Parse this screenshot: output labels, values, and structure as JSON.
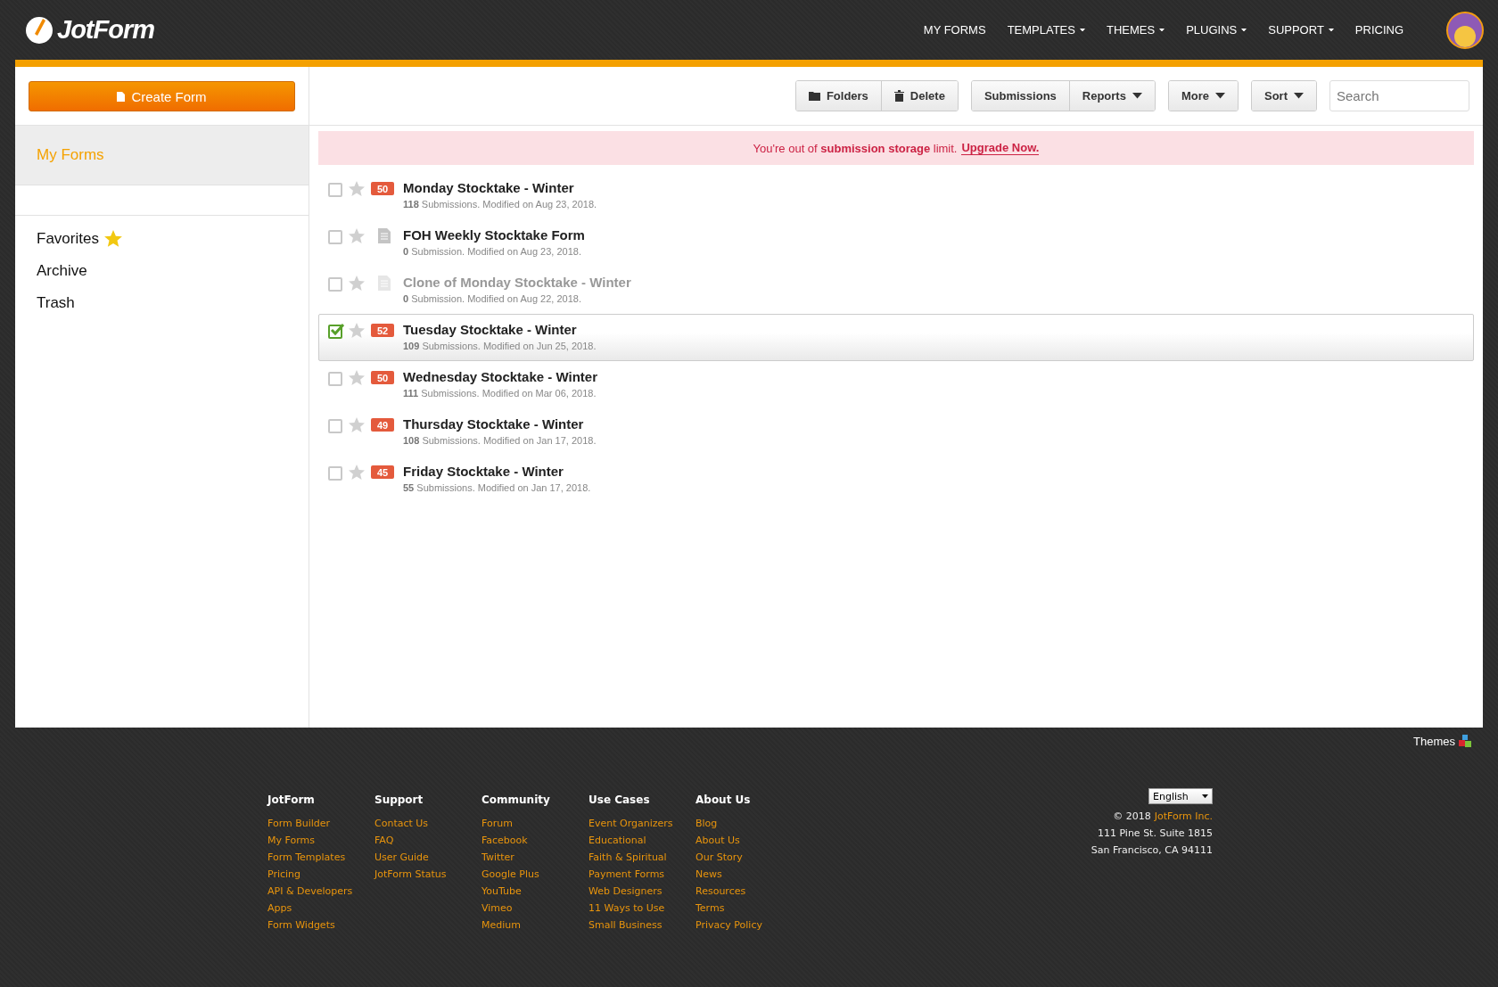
{
  "header": {
    "logo": "JotForm",
    "nav": [
      {
        "label": "MY FORMS",
        "dropdown": false
      },
      {
        "label": "TEMPLATES",
        "dropdown": true
      },
      {
        "label": "THEMES",
        "dropdown": true
      },
      {
        "label": "PLUGINS",
        "dropdown": true
      },
      {
        "label": "SUPPORT",
        "dropdown": true
      },
      {
        "label": "PRICING",
        "dropdown": false
      }
    ]
  },
  "sidebar": {
    "create_button": "Create Form",
    "items": [
      {
        "label": "My Forms",
        "selected": true,
        "kind": "main"
      },
      {
        "label": "Favorites",
        "selected": false,
        "kind": "favorites"
      },
      {
        "label": "Archive",
        "selected": false,
        "kind": "plain"
      },
      {
        "label": "Trash",
        "selected": false,
        "kind": "plain"
      }
    ]
  },
  "toolbar": {
    "groups": [
      [
        {
          "label": "Folders",
          "kind": "folders"
        },
        {
          "label": "Delete",
          "kind": "delete"
        }
      ],
      [
        {
          "label": "Submissions",
          "kind": "plain"
        },
        {
          "label": "Reports",
          "kind": "menu"
        }
      ],
      [
        {
          "label": "More",
          "kind": "menu"
        }
      ],
      [
        {
          "label": "Sort",
          "kind": "menu"
        }
      ]
    ],
    "search": {
      "placeholder": "Search"
    }
  },
  "alert": {
    "text": "You're out of **submission storage** limit.",
    "link": "Upgrade Now."
  },
  "forms": [
    {
      "title": "Monday Stocktake - Winter",
      "details": "**118** Submissions. Modified on Aug 23, 2018.",
      "badge": "50",
      "kind": "badge",
      "checked": false,
      "selected": false,
      "disabled": false
    },
    {
      "title": "FOH Weekly Stocktake Form",
      "details": "**0** Submission. Modified on Aug 23, 2018.",
      "kind": "doc",
      "checked": false,
      "selected": false,
      "disabled": false
    },
    {
      "title": "Clone of Monday Stocktake - Winter",
      "details": "**0** Submission. Modified on Aug 22, 2018.",
      "kind": "doc",
      "checked": false,
      "selected": false,
      "disabled": true
    },
    {
      "title": "Tuesday Stocktake - Winter",
      "details": "**109** Submissions. Modified on Jun 25, 2018.",
      "badge": "52",
      "kind": "badge",
      "checked": true,
      "selected": true,
      "disabled": false
    },
    {
      "title": "Wednesday Stocktake - Winter",
      "details": "**111** Submissions. Modified on Mar 06, 2018.",
      "badge": "50",
      "kind": "badge",
      "checked": false,
      "selected": false,
      "disabled": false
    },
    {
      "title": "Thursday Stocktake - Winter",
      "details": "**108** Submissions. Modified on Jan 17, 2018.",
      "badge": "49",
      "kind": "badge",
      "checked": false,
      "selected": false,
      "disabled": false
    },
    {
      "title": "Friday Stocktake - Winter",
      "details": "**55** Submissions. Modified on Jan 17, 2018.",
      "badge": "45",
      "kind": "badge",
      "checked": false,
      "selected": false,
      "disabled": false
    }
  ],
  "themes_link": "Themes",
  "footer": {
    "columns": [
      {
        "heading": "JotForm",
        "links": [
          "Form Builder",
          "My Forms",
          "Form Templates",
          "Pricing",
          "API & Developers",
          "Apps",
          "Form Widgets"
        ]
      },
      {
        "heading": "Support",
        "links": [
          "Contact Us",
          "FAQ",
          "User Guide",
          "JotForm Status"
        ]
      },
      {
        "heading": "Community",
        "links": [
          "Forum",
          "Facebook",
          "Twitter",
          "Google Plus",
          "YouTube",
          "Vimeo",
          "Medium"
        ]
      },
      {
        "heading": "Use Cases",
        "links": [
          "Event Organizers",
          "Educational",
          "Faith & Spiritual",
          "Payment Forms",
          "Web Designers",
          "11 Ways to Use",
          "Small Business"
        ]
      },
      {
        "heading": "About Us",
        "links": [
          "Blog",
          "About Us",
          "Our Story",
          "News",
          "Resources",
          "Terms",
          "Privacy Policy"
        ]
      }
    ],
    "language": "English",
    "copyright": "© 2018",
    "company_link": "JotForm Inc.",
    "address": [
      "111 Pine St. Suite 1815",
      "San Francisco, CA 94111"
    ]
  }
}
